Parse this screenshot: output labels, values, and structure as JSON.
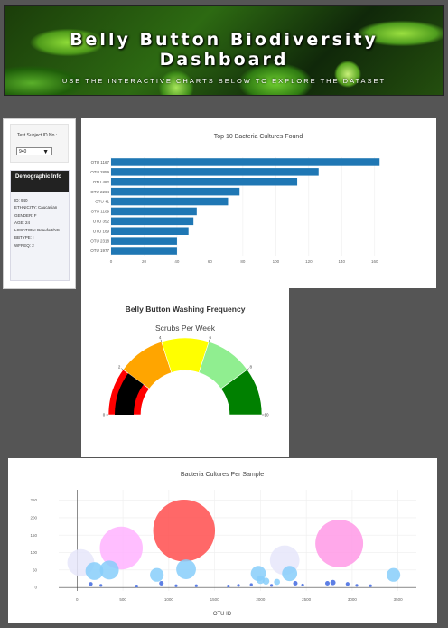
{
  "header": {
    "title": "Belly Button Biodiversity Dashboard",
    "subtitle": "USE THE INTERACTIVE CHARTS BELOW TO EXPLORE THE DATASET"
  },
  "sidebar": {
    "select_label": "Test Subject ID No.:",
    "selected_id": "940"
  },
  "demographics": {
    "title": "Demographic Info",
    "rows": [
      "ID: 940",
      "ETHNICITY: Caucasian",
      "GENDER: F",
      "AGE: 24",
      "LOCATION: Beaufort/NC",
      "BBTYPE: I",
      "WFREQ: 2"
    ]
  },
  "bar_chart": {
    "chart_data": {
      "type": "bar",
      "orientation": "horizontal",
      "title": "Top 10 Bacteria Cultures Found",
      "categories": [
        "OTU 1167",
        "OTU 2859",
        "OTU 482",
        "OTU 2264",
        "OTU 41",
        "OTU 1189",
        "OTU 352",
        "OTU 189",
        "OTU 2318",
        "OTU 1977"
      ],
      "values": [
        163,
        126,
        113,
        78,
        71,
        52,
        50,
        47,
        40,
        40
      ],
      "xlim": [
        0,
        170
      ],
      "xticks": [
        0,
        20,
        40,
        60,
        80,
        100,
        120,
        140,
        160
      ],
      "color": "#1f77b4",
      "grid": true
    }
  },
  "gauge": {
    "chart_data": {
      "type": "gauge",
      "title": "Belly Button Washing Frequency",
      "subtitle": "Scrubs Per Week",
      "value": 2,
      "range": [
        0,
        10
      ],
      "ticks": [
        0,
        2,
        4,
        6,
        8,
        10
      ],
      "bands": [
        {
          "from": 0,
          "to": 2,
          "color": "#ff0000"
        },
        {
          "from": 2,
          "to": 4,
          "color": "#ffa500"
        },
        {
          "from": 4,
          "to": 6,
          "color": "#ffff00"
        },
        {
          "from": 6,
          "to": 8,
          "color": "#90ee90"
        },
        {
          "from": 8,
          "to": 10,
          "color": "#008000"
        }
      ]
    }
  },
  "bubble_chart": {
    "chart_data": {
      "type": "scatter",
      "title": "Bacteria Cultures Per Sample",
      "xlabel": "OTU ID",
      "xlim": [
        -200,
        3700
      ],
      "ylim": [
        -10,
        280
      ],
      "xticks": [
        0,
        500,
        1000,
        1500,
        2000,
        2500,
        3000,
        3500
      ],
      "yticks": [
        0,
        50,
        100,
        150,
        200,
        250
      ],
      "points": [
        {
          "x": 41,
          "y": 71,
          "color": "#e6e6fa"
        },
        {
          "x": 189,
          "y": 47,
          "color": "#87cefa"
        },
        {
          "x": 352,
          "y": 50,
          "color": "#87cefa"
        },
        {
          "x": 482,
          "y": 113,
          "color": "#ffb3ff"
        },
        {
          "x": 870,
          "y": 36,
          "color": "#87cefa"
        },
        {
          "x": 1167,
          "y": 163,
          "color": "#ff4d4d"
        },
        {
          "x": 1189,
          "y": 52,
          "color": "#87cefa"
        },
        {
          "x": 1977,
          "y": 40,
          "color": "#87cefa"
        },
        {
          "x": 2264,
          "y": 78,
          "color": "#e6e6fa"
        },
        {
          "x": 2318,
          "y": 40,
          "color": "#87cefa"
        },
        {
          "x": 2859,
          "y": 126,
          "color": "#ff99e6"
        },
        {
          "x": 3450,
          "y": 36,
          "color": "#87cefa"
        },
        {
          "x": 2000,
          "y": 22,
          "color": "#87cefa"
        },
        {
          "x": 2060,
          "y": 18,
          "color": "#87cefa"
        },
        {
          "x": 2180,
          "y": 16,
          "color": "#87cefa"
        },
        {
          "x": 150,
          "y": 10,
          "color": "#4169e1"
        },
        {
          "x": 260,
          "y": 6,
          "color": "#4169e1"
        },
        {
          "x": 920,
          "y": 12,
          "color": "#4169e1"
        },
        {
          "x": 1300,
          "y": 5,
          "color": "#4169e1"
        },
        {
          "x": 1650,
          "y": 4,
          "color": "#4169e1"
        },
        {
          "x": 1760,
          "y": 6,
          "color": "#4169e1"
        },
        {
          "x": 1900,
          "y": 8,
          "color": "#4169e1"
        },
        {
          "x": 2120,
          "y": 6,
          "color": "#4169e1"
        },
        {
          "x": 2380,
          "y": 12,
          "color": "#4169e1"
        },
        {
          "x": 2460,
          "y": 7,
          "color": "#4169e1"
        },
        {
          "x": 2730,
          "y": 12,
          "color": "#4169e1"
        },
        {
          "x": 2790,
          "y": 14,
          "color": "#4169e1"
        },
        {
          "x": 2950,
          "y": 10,
          "color": "#4169e1"
        },
        {
          "x": 3050,
          "y": 6,
          "color": "#4169e1"
        },
        {
          "x": 3200,
          "y": 5,
          "color": "#4169e1"
        },
        {
          "x": 650,
          "y": 4,
          "color": "#4169e1"
        },
        {
          "x": 1080,
          "y": 5,
          "color": "#4169e1"
        }
      ]
    }
  }
}
